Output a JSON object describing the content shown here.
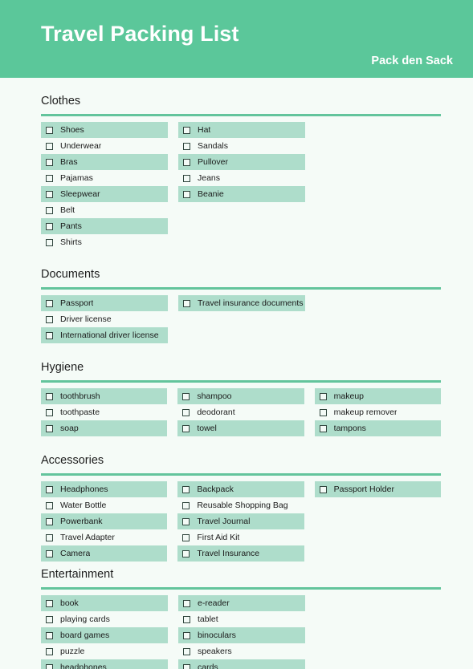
{
  "header": {
    "title": "Travel Packing List",
    "subtitle": "Pack den Sack",
    "background_color": "#5bc79a",
    "text_color": "#ffffff"
  },
  "theme": {
    "page_background": "#f5fbf7",
    "row_shaded_color": "#aeddcb",
    "rule_color": "#63c49c",
    "checkbox_border_color": "#31463e",
    "text_color": "#1a1a1a"
  },
  "sections": [
    {
      "title": "Clothes",
      "columns": [
        {
          "items": [
            {
              "label": "Shoes",
              "checked": false,
              "shaded": true
            },
            {
              "label": "Underwear",
              "checked": false,
              "shaded": false
            },
            {
              "label": "Bras",
              "checked": false,
              "shaded": true
            },
            {
              "label": "Pajamas",
              "checked": false,
              "shaded": false
            },
            {
              "label": "Sleepwear",
              "checked": false,
              "shaded": true
            },
            {
              "label": "Belt",
              "checked": false,
              "shaded": false
            },
            {
              "label": "Pants",
              "checked": false,
              "shaded": true
            },
            {
              "label": "Shirts",
              "checked": false,
              "shaded": false
            }
          ]
        },
        {
          "items": [
            {
              "label": "Hat",
              "checked": false,
              "shaded": true
            },
            {
              "label": "Sandals",
              "checked": false,
              "shaded": false
            },
            {
              "label": "Pullover",
              "checked": false,
              "shaded": true
            },
            {
              "label": "Jeans",
              "checked": false,
              "shaded": false
            },
            {
              "label": "Beanie",
              "checked": false,
              "shaded": true
            }
          ]
        }
      ]
    },
    {
      "title": "Documents",
      "columns": [
        {
          "items": [
            {
              "label": "Passport",
              "checked": false,
              "shaded": true
            },
            {
              "label": "Driver license",
              "checked": false,
              "shaded": false
            },
            {
              "label": "International driver license",
              "checked": false,
              "shaded": true
            }
          ]
        },
        {
          "items": [
            {
              "label": "Travel insurance documents",
              "checked": false,
              "shaded": true
            }
          ]
        }
      ]
    },
    {
      "title": "Hygiene",
      "columns": [
        {
          "items": [
            {
              "label": "toothbrush",
              "checked": false,
              "shaded": true
            },
            {
              "label": "toothpaste",
              "checked": false,
              "shaded": false
            },
            {
              "label": "soap",
              "checked": false,
              "shaded": true
            }
          ]
        },
        {
          "items": [
            {
              "label": "shampoo",
              "checked": false,
              "shaded": true
            },
            {
              "label": "deodorant",
              "checked": false,
              "shaded": false
            },
            {
              "label": "towel",
              "checked": false,
              "shaded": true
            }
          ]
        },
        {
          "items": [
            {
              "label": "makeup",
              "checked": false,
              "shaded": true
            },
            {
              "label": "makeup remover",
              "checked": false,
              "shaded": false
            },
            {
              "label": "tampons",
              "checked": false,
              "shaded": true
            }
          ]
        }
      ]
    },
    {
      "title": "Accessories",
      "columns": [
        {
          "items": [
            {
              "label": "Headphones",
              "checked": false,
              "shaded": true
            },
            {
              "label": "Water Bottle",
              "checked": false,
              "shaded": false
            },
            {
              "label": "Powerbank",
              "checked": false,
              "shaded": true
            },
            {
              "label": "Travel Adapter",
              "checked": false,
              "shaded": false
            },
            {
              "label": "Camera",
              "checked": false,
              "shaded": true
            }
          ]
        },
        {
          "items": [
            {
              "label": "Backpack",
              "checked": false,
              "shaded": true
            },
            {
              "label": "Reusable Shopping Bag",
              "checked": false,
              "shaded": false
            },
            {
              "label": "Travel Journal",
              "checked": false,
              "shaded": true
            },
            {
              "label": "First Aid Kit",
              "checked": false,
              "shaded": false
            },
            {
              "label": "Travel Insurance",
              "checked": false,
              "shaded": true
            }
          ]
        },
        {
          "items": [
            {
              "label": "Passport Holder",
              "checked": false,
              "shaded": true
            }
          ]
        }
      ]
    },
    {
      "title": "Entertainment",
      "columns": [
        {
          "items": [
            {
              "label": "book",
              "checked": false,
              "shaded": true
            },
            {
              "label": "playing cards",
              "checked": false,
              "shaded": false
            },
            {
              "label": "board games",
              "checked": false,
              "shaded": true
            },
            {
              "label": "puzzle",
              "checked": false,
              "shaded": false
            },
            {
              "label": "headphones",
              "checked": false,
              "shaded": true
            }
          ]
        },
        {
          "items": [
            {
              "label": "e-reader",
              "checked": false,
              "shaded": true
            },
            {
              "label": "tablet",
              "checked": false,
              "shaded": false
            },
            {
              "label": "binoculars",
              "checked": false,
              "shaded": true
            },
            {
              "label": "speakers",
              "checked": false,
              "shaded": false
            },
            {
              "label": "cards",
              "checked": false,
              "shaded": true
            }
          ]
        }
      ]
    }
  ]
}
